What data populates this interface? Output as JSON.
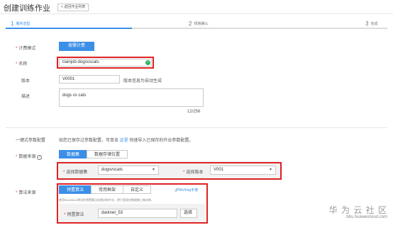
{
  "header": {
    "title": "创建训练作业",
    "back_label": "< 返回作业列表"
  },
  "steps": [
    {
      "num": "1",
      "label": "服务选型"
    },
    {
      "num": "2",
      "label": "规格确认"
    },
    {
      "num": "3",
      "label": "完成"
    }
  ],
  "billing": {
    "label": "计费模式",
    "value": "按需计费"
  },
  "name": {
    "label": "名称",
    "value": "trainjob-dogsvscats"
  },
  "version": {
    "label": "版本",
    "value": "V0001",
    "hint": "版本信息为自动生成"
  },
  "description": {
    "label": "描述",
    "value": "dogs vs cats",
    "counter": "12/256"
  },
  "oneclick": {
    "label": "一键式参数配置",
    "text_before": "如您已保存过参数配置，可单击",
    "link": "这里",
    "text_after": "快速导入已保存的作业参数配置。"
  },
  "datasource": {
    "label": "数据来源",
    "tabs": [
      "数据集",
      "数据存储位置"
    ],
    "dataset_label": "选择数据集",
    "dataset_value": "dogsvscats",
    "version_label": "选择版本",
    "version_value": "V001"
  },
  "algorithm": {
    "label": "算法来源",
    "tabs": [
      "预置算法",
      "常用框架",
      "自定义"
    ],
    "link": "MoXing手册",
    "note": "使用ModelArts预设的预置算法创建训练作业，便于直接在数据集上做训练。",
    "preset_label": "预置算法",
    "preset_value": "darknet_53",
    "select_label": "选择"
  },
  "watermark": {
    "name": "华 为 云 社 区",
    "url": "bbs.huaweicloud.com"
  },
  "colors": {
    "accent": "#3b8fe7",
    "highlight": "#e02222",
    "success": "#2fb35b"
  }
}
